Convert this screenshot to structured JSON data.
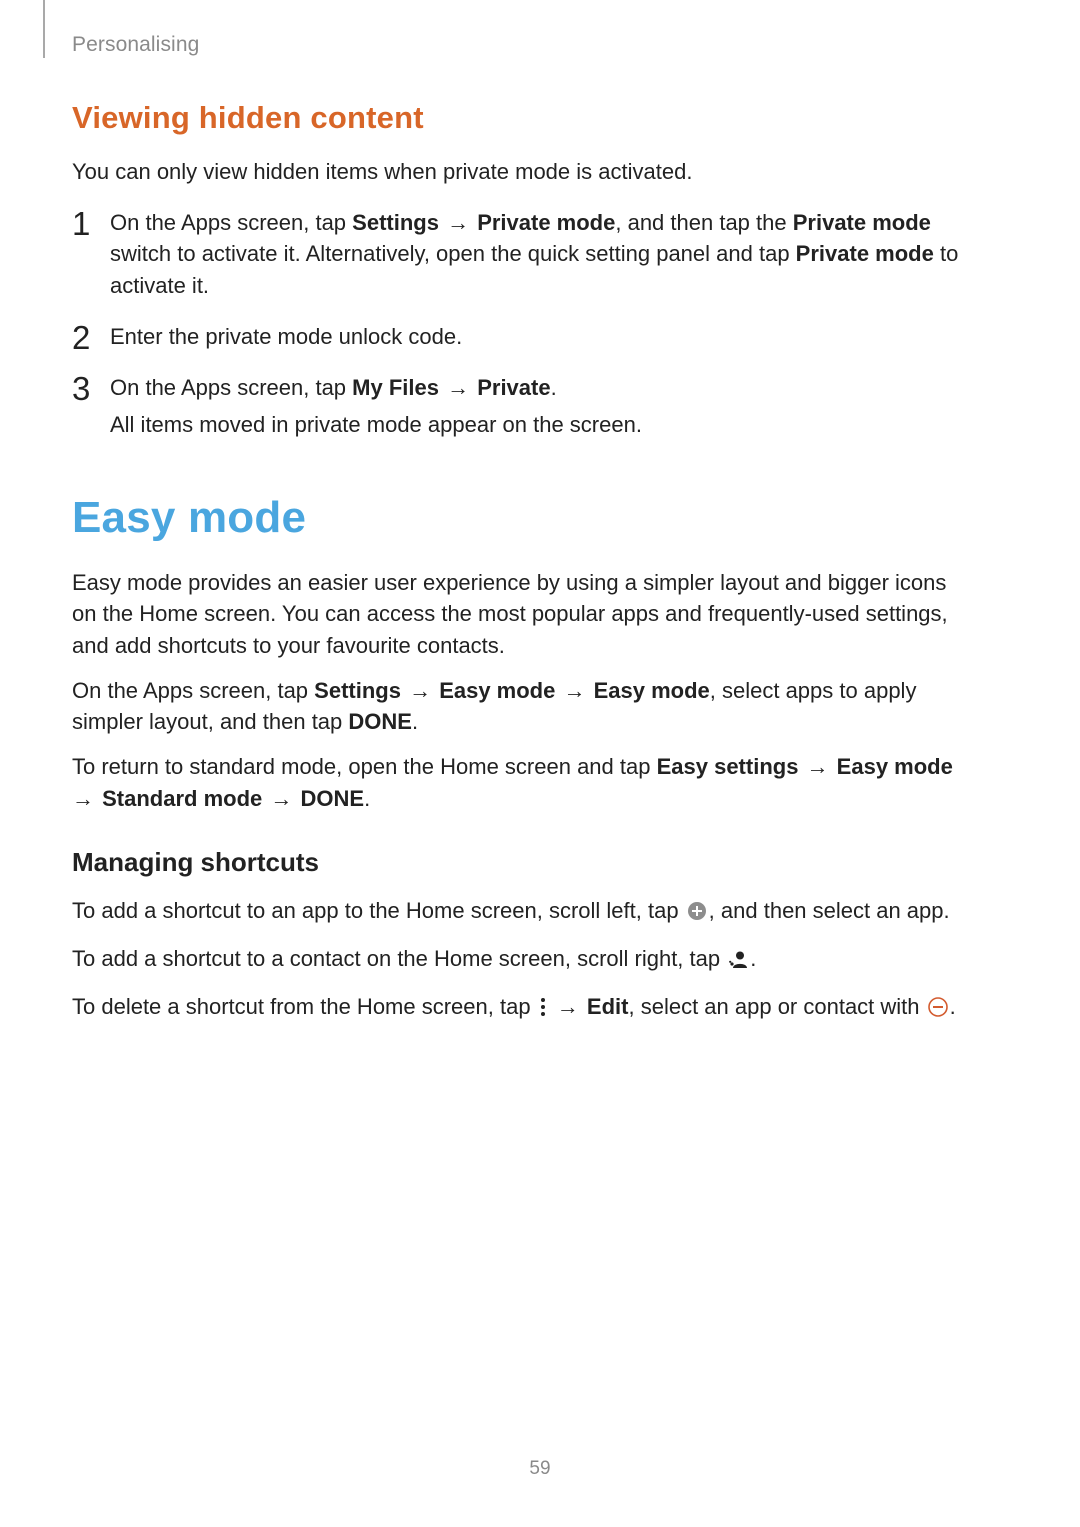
{
  "header": {
    "section": "Personalising"
  },
  "section_a": {
    "heading": "Viewing hidden content",
    "lead": "You can only view hidden items when private mode is activated.",
    "steps": {
      "s1": {
        "pre1": "On the Apps screen, tap ",
        "b1": "Settings",
        "arrow1": " → ",
        "b2": "Private mode",
        "mid1": ", and then tap the ",
        "b3": "Private mode",
        "post1": " switch to activate it. Alternatively, open the quick setting panel and tap ",
        "b4": "Private mode",
        "post2": " to activate it."
      },
      "s2": "Enter the private mode unlock code.",
      "s3": {
        "pre1": "On the Apps screen, tap ",
        "b1": "My Files",
        "arrow1": " → ",
        "b2": "Private",
        "post1": ".",
        "line2": "All items moved in private mode appear on the screen."
      }
    }
  },
  "section_b": {
    "heading": "Easy mode",
    "para1": "Easy mode provides an easier user experience by using a simpler layout and bigger icons on the Home screen. You can access the most popular apps and frequently-used settings, and add shortcuts to your favourite contacts.",
    "para2": {
      "pre1": "On the Apps screen, tap ",
      "b1": "Settings",
      "arrow1": " → ",
      "b2": "Easy mode",
      "arrow2": " → ",
      "b3": "Easy mode",
      "mid1": ", select apps to apply simpler layout, and then tap ",
      "b4": "DONE",
      "post1": "."
    },
    "para3": {
      "pre1": "To return to standard mode, open the Home screen and tap ",
      "b1": "Easy settings",
      "arrow1": " → ",
      "b2": "Easy mode",
      "arrow2": " → ",
      "b3": "Standard mode",
      "arrow3": " → ",
      "b4": "DONE",
      "post1": "."
    },
    "subheading": "Managing shortcuts",
    "line1": {
      "pre": "To add a shortcut to an app to the Home screen, scroll left, tap ",
      "post": ", and then select an app."
    },
    "line2": {
      "pre": "To add a shortcut to a contact on the Home screen, scroll right, tap ",
      "post": "."
    },
    "line3": {
      "pre": "To delete a shortcut from the Home screen, tap ",
      "arrow": " → ",
      "b1": "Edit",
      "mid": ", select an app or contact with ",
      "post": "."
    }
  },
  "page_number": "59"
}
